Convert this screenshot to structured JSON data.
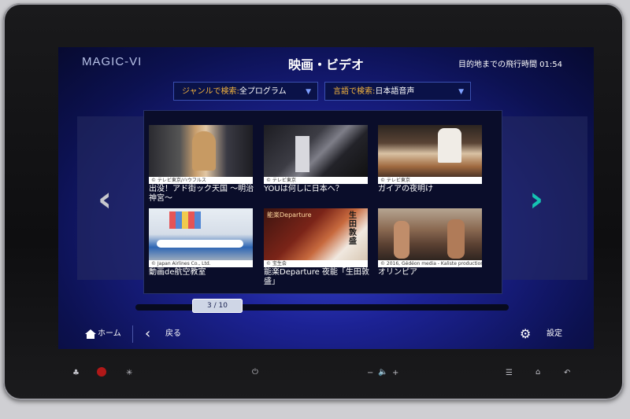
{
  "header": {
    "logo": "MAGIC-VI",
    "title": "映画・ビデオ",
    "flight_time": "目的地までの飛行時間 01:54"
  },
  "filters": {
    "genre_key": "ジャンルで検索:",
    "genre_value": "全プログラム",
    "language_key": "言語で検索:",
    "language_value": "日本語音声"
  },
  "tiles": [
    {
      "credit": "© テレビ東京/ハウフルス",
      "label": "出没！アド街ック天国 〜明治神宮〜"
    },
    {
      "credit": "© テレビ東京",
      "label": "YOUは何しに日本へ？"
    },
    {
      "credit": "© テレビ東京",
      "label": "ガイアの夜明け"
    },
    {
      "credit": "© Japan Airlines Co., Ltd.",
      "label": "動画de航空教室"
    },
    {
      "credit": "© 宝生会",
      "label": "能楽Departure 夜能「生田敦盛」"
    },
    {
      "credit": "© 2016, Gédéon media - Kaliste productions",
      "label": "オリンピア"
    }
  ],
  "thumb_text": {
    "noh_banner": "能楽Departure",
    "noh_title": "生田敦盛"
  },
  "pager": "3 / 10",
  "footer": {
    "home": "ホーム",
    "back": "戻る",
    "settings": "設定"
  },
  "hardware": {
    "volume_minus": "−",
    "volume_plus": "+"
  },
  "colors": {
    "accent_next_arrow": "#15c3b2",
    "filter_key": "#f7b63d"
  }
}
